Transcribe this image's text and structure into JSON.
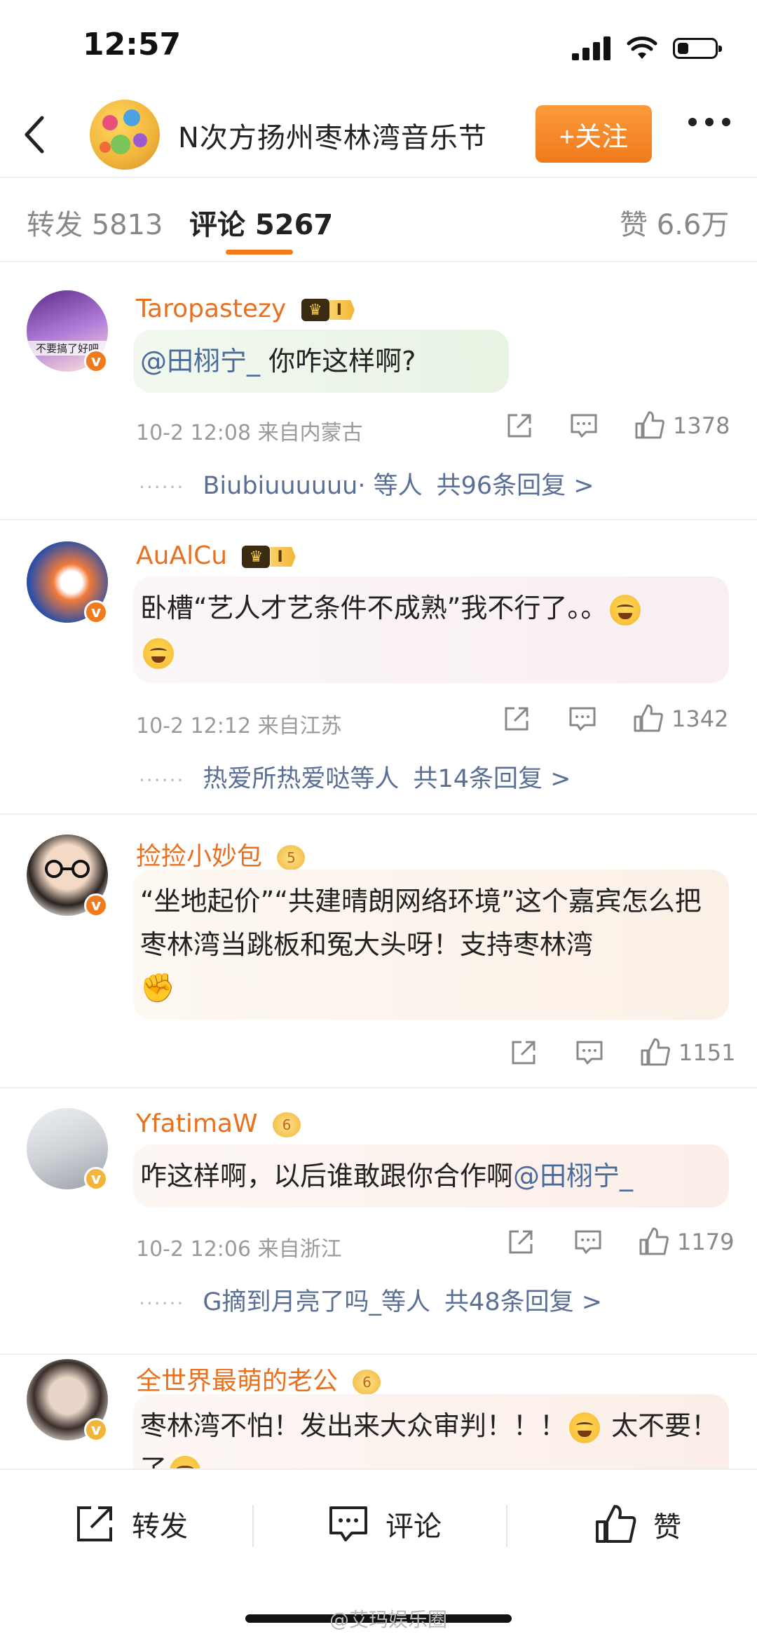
{
  "status_bar": {
    "time": "12:57",
    "battery_level": 0.3
  },
  "header": {
    "title": "N次方扬州枣林湾音乐节",
    "follow_label": "+关注"
  },
  "tabs": {
    "repost": "转发 5813",
    "comments": "评论 5267",
    "likes": "赞 6.6万"
  },
  "comments": [
    {
      "username": "Taropastezy",
      "vip_level": "I",
      "avatar_text": "不要搞了好吧",
      "mention": "@田栩宁_",
      "text": " 你咋这样啊?",
      "time_location": "10-2 12:08  来自内蒙古",
      "likes": "1378",
      "reply_names": "Biubiuuuuuu·",
      "reply_suffix": " 等人",
      "reply_count": "共96条回复 >"
    },
    {
      "username": "AuAlCu",
      "vip_level": "I",
      "text": "卧槽“艺人才艺条件不成熟”我不行了。。",
      "time_location": "10-2 12:12  来自江苏",
      "likes": "1342",
      "reply_names": "热爱所热爱哒",
      "reply_suffix": "等人",
      "reply_count": "共14条回复 >"
    },
    {
      "username": "捡捡小妙包",
      "vip_level": "5",
      "text": "“坐地起价”“共建晴朗网络环境”这个嘉宾怎么把枣林湾当跳板和冤大头呀！支持枣林湾",
      "likes": "1151"
    },
    {
      "username": "YfatimaW",
      "vip_level": "6",
      "text": "咋这样啊，以后谁敢跟你合作啊",
      "mention": "@田栩宁_",
      "time_location": "10-2 12:06  来自浙江",
      "likes": "1179",
      "reply_names": "G摘到月亮了吗_",
      "reply_suffix": "等人",
      "reply_count": "共48条回复 >"
    },
    {
      "username": "全世界最萌的老公",
      "vip_level": "6",
      "text": "枣林湾不怕！发出来大众审判！！！",
      "text_after_emoji": " 太不要！了"
    }
  ],
  "bottom_bar": {
    "repost": "转发",
    "comment": "评论",
    "like": "赞"
  },
  "watermark": "@艾玛娱乐圈"
}
